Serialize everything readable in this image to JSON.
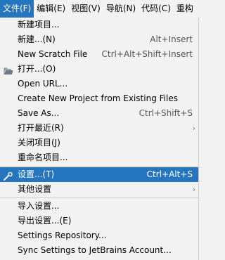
{
  "menubar": {
    "items": [
      {
        "label": "文件(F)"
      },
      {
        "label": "编辑(E)"
      },
      {
        "label": "视图(V)"
      },
      {
        "label": "导航(N)"
      },
      {
        "label": "代码(C)"
      },
      {
        "label": "重构"
      }
    ]
  },
  "file_menu": {
    "items": [
      {
        "label": "新建项目...",
        "shortcut": ""
      },
      {
        "label": "新建...(N)",
        "shortcut": "Alt+Insert"
      },
      {
        "label": "New Scratch File",
        "shortcut": "Ctrl+Alt+Shift+Insert"
      },
      {
        "label": "打开...(O)",
        "shortcut": "",
        "icon": "folder-icon"
      },
      {
        "label": "Open URL...",
        "shortcut": ""
      },
      {
        "label": "Create New Project from Existing Files",
        "shortcut": ""
      },
      {
        "label": "Save As...",
        "shortcut": "Ctrl+Shift+S"
      },
      {
        "label": "打开最近(R)",
        "shortcut": "",
        "submenu": true
      },
      {
        "label": "关闭项目(J)",
        "shortcut": ""
      },
      {
        "label": "重命名项目...",
        "shortcut": ""
      },
      {
        "label": "设置...(T)",
        "shortcut": "Ctrl+Alt+S",
        "icon": "wrench-icon",
        "selected": true
      },
      {
        "label": "其他设置",
        "shortcut": "",
        "submenu": true
      },
      {
        "label": "导入设置...",
        "shortcut": ""
      },
      {
        "label": "导出设置...(E)",
        "shortcut": ""
      },
      {
        "label": "Settings Repository...",
        "shortcut": ""
      },
      {
        "label": "Sync Settings to JetBrains Account...",
        "shortcut": ""
      }
    ],
    "submenu_arrow": "›"
  },
  "colors": {
    "accent": "#2675bf",
    "background": "#f2f2f2",
    "separator": "#cfcfcf"
  }
}
